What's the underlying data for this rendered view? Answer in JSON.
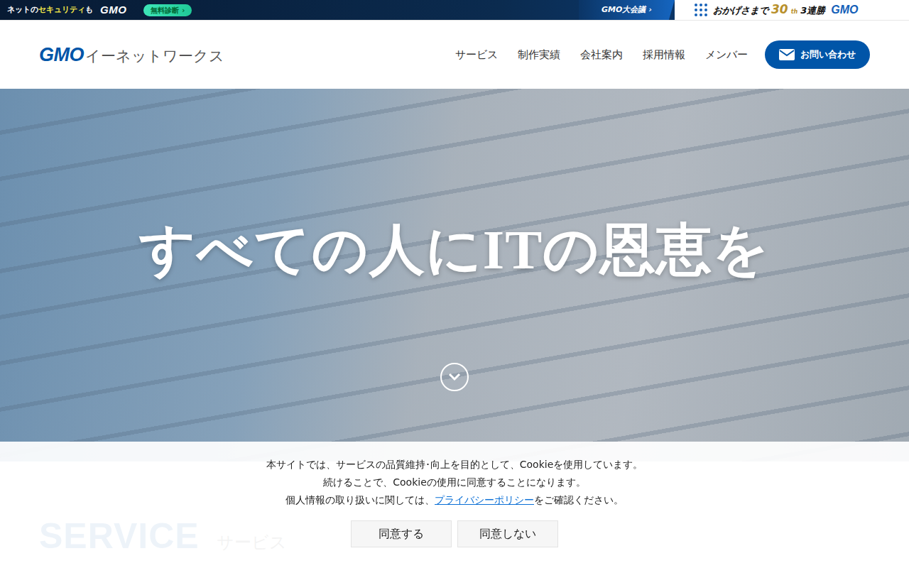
{
  "top_banner": {
    "lead": "ネットの",
    "highlight": "セキュリティ",
    "tail": "も",
    "brand": "GMO",
    "cta": "無料診断",
    "cta_arrow": "›",
    "event": "GMO大会議",
    "event_arrow": "›",
    "thanks": "おかげさまで",
    "anniv_number": "30",
    "anniv_suffix": "th",
    "streak": "3連勝",
    "group_brand": "GMO"
  },
  "header": {
    "logo_mark": "GMO",
    "logo_text": "イーネットワークス",
    "nav": [
      "サービス",
      "制作実績",
      "会社案内",
      "採用情報",
      "メンバー"
    ],
    "contact": "お問い合わせ"
  },
  "hero": {
    "title": "すべての人にITの恩恵を"
  },
  "section": {
    "title_en": "SERVICE",
    "title_ja": "サービス"
  },
  "cookie": {
    "lines": [
      "本サイトでは、サービスの品質維持･向上を目的として、Cookieを使用しています。",
      "続けることで、Cookieの使用に同意することになります。"
    ],
    "policy_prefix": "個人情報の取り扱いに関しては、",
    "policy_link": "プライバシーポリシー",
    "policy_suffix": "をご確認ください。",
    "buttons": [
      "同意する",
      "同意しない"
    ]
  }
}
